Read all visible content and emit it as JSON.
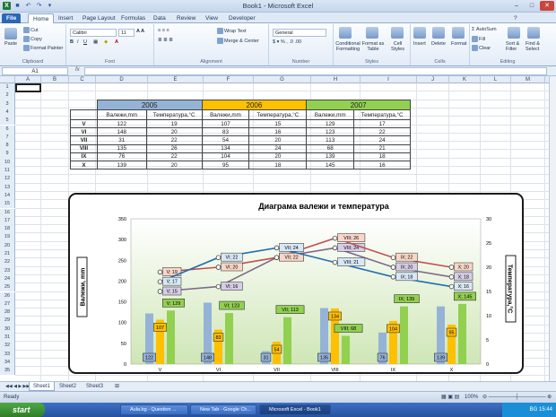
{
  "window": {
    "title": "Book1  -  Microsoft Excel"
  },
  "ribbon": {
    "tabs": [
      "File",
      "Home",
      "Insert",
      "Page Layout",
      "Formulas",
      "Data",
      "Review",
      "View",
      "Developer"
    ],
    "clipboard": {
      "paste": "Paste",
      "cut": "Cut",
      "copy": "Copy",
      "format_painter": "Format Painter",
      "label": "Clipboard"
    },
    "font": {
      "name": "Calibri",
      "size": "11",
      "label": "Font"
    },
    "alignment": {
      "wrap": "Wrap Text",
      "merge": "Merge & Center",
      "label": "Alignment"
    },
    "number": {
      "format": "General",
      "label": "Number"
    },
    "styles": {
      "cond": "Conditional Formatting",
      "table": "Format as Table",
      "cell": "Cell Styles",
      "label": "Styles"
    },
    "cells": {
      "insert": "Insert",
      "delete": "Delete",
      "format": "Format",
      "label": "Cells"
    },
    "editing": {
      "autosum": "AutoSum",
      "fill": "Fill",
      "clear": "Clear",
      "sort": "Sort & Filter",
      "find": "Find & Select",
      "label": "Editing"
    }
  },
  "formula_bar": {
    "name_box": "A1",
    "fx": "fx",
    "value": ""
  },
  "columns": [
    "A",
    "B",
    "C",
    "D",
    "E",
    "F",
    "G",
    "H",
    "I",
    "J",
    "K",
    "L",
    "M",
    "N"
  ],
  "rows": [
    "1",
    "2",
    "3",
    "4",
    "5",
    "6",
    "7",
    "8",
    "9",
    "10",
    "11",
    "12",
    "13",
    "14",
    "15",
    "16",
    "17",
    "18",
    "19",
    "20",
    "21",
    "22",
    "23",
    "24",
    "25",
    "26",
    "27",
    "28",
    "29",
    "30",
    "31",
    "32",
    "33",
    "34",
    "35"
  ],
  "table": {
    "years": [
      "2005",
      "2006",
      "2007"
    ],
    "year_colors": [
      "#95b3d7",
      "#ffc000",
      "#92d050"
    ],
    "sub_headers": [
      "Валежи,mm",
      "Температура,°C",
      "Валежи,mm",
      "Температура,°C",
      "Валежи,mm",
      "Температура,°C"
    ],
    "rows": [
      {
        "month": "V",
        "values": [
          "122",
          "19",
          "107",
          "15",
          "129",
          "17"
        ]
      },
      {
        "month": "VI",
        "values": [
          "148",
          "20",
          "83",
          "16",
          "123",
          "22"
        ]
      },
      {
        "month": "VII",
        "values": [
          "31",
          "22",
          "54",
          "20",
          "113",
          "24"
        ]
      },
      {
        "month": "VIII",
        "values": [
          "135",
          "26",
          "134",
          "24",
          "68",
          "21"
        ]
      },
      {
        "month": "IX",
        "values": [
          "76",
          "22",
          "104",
          "20",
          "139",
          "18"
        ]
      },
      {
        "month": "X",
        "values": [
          "139",
          "20",
          "95",
          "18",
          "145",
          "16"
        ]
      }
    ]
  },
  "chart_data": {
    "type": "bar",
    "title": "Диаграма валежи и температура",
    "ylabel": "Валежи, mm",
    "y2label": "Температура,°C",
    "categories": [
      "V",
      "VI",
      "VII",
      "VIII",
      "IX",
      "X"
    ],
    "ylim": [
      0,
      350
    ],
    "y2lim": [
      0,
      30
    ],
    "yticks": [
      "0",
      "50",
      "100",
      "150",
      "200",
      "250",
      "300",
      "350"
    ],
    "y2ticks": [
      "0",
      "5",
      "10",
      "15",
      "20",
      "25",
      "30"
    ],
    "bar_series": [
      {
        "year": "2005",
        "color": "#95b3d7",
        "values": [
          122,
          148,
          31,
          135,
          76,
          139
        ]
      },
      {
        "year": "2006",
        "color": "#ffc000",
        "values": [
          107,
          83,
          54,
          134,
          104,
          95
        ]
      },
      {
        "year": "2007",
        "color": "#92d050",
        "values": [
          129,
          123,
          113,
          68,
          139,
          145
        ]
      }
    ],
    "line_series": [
      {
        "year": "2005",
        "color": "#7f6a8c",
        "values": [
          15,
          16,
          22,
          24,
          20,
          18
        ]
      },
      {
        "year": "2006",
        "color": "#c0504d",
        "values": [
          19,
          20,
          22,
          26,
          22,
          20
        ]
      },
      {
        "year": "2007",
        "color": "#1f6fb2",
        "values": [
          17,
          22,
          24,
          21,
          18,
          16
        ]
      }
    ],
    "line_labels": [
      [
        "V; 15",
        "VI; 16",
        "VII; 22",
        "VIII; 24",
        "IX; 20",
        "X; 18"
      ],
      [
        "V; 19",
        "VI; 20",
        "VII; 22",
        "VIII; 26",
        "IX; 22",
        "X; 20"
      ],
      [
        "V; 17",
        "VI; 22",
        "VII; 24",
        "VIII; 21",
        "IX; 18",
        "X; 16"
      ]
    ],
    "bar_labels": [
      [
        "122",
        "148",
        "31",
        "135",
        "76",
        "139"
      ],
      [
        "107",
        "83",
        "54",
        "134",
        "104",
        "95"
      ],
      [
        "V; 129",
        "VI; 123",
        "VII; 113",
        "VIII; 68",
        "IX; 139",
        "X; 145"
      ]
    ]
  },
  "sheets": [
    "Sheet1",
    "Sheet2",
    "Sheet3"
  ],
  "status": {
    "ready": "Ready",
    "zoom": "100%"
  },
  "taskbar": {
    "start": "start",
    "items": [
      "Aula.bg - Question ...",
      "New Tab - Google Ch...",
      "Microsoft Excel - Book1"
    ],
    "lang": "BG",
    "clock": "15:44"
  }
}
